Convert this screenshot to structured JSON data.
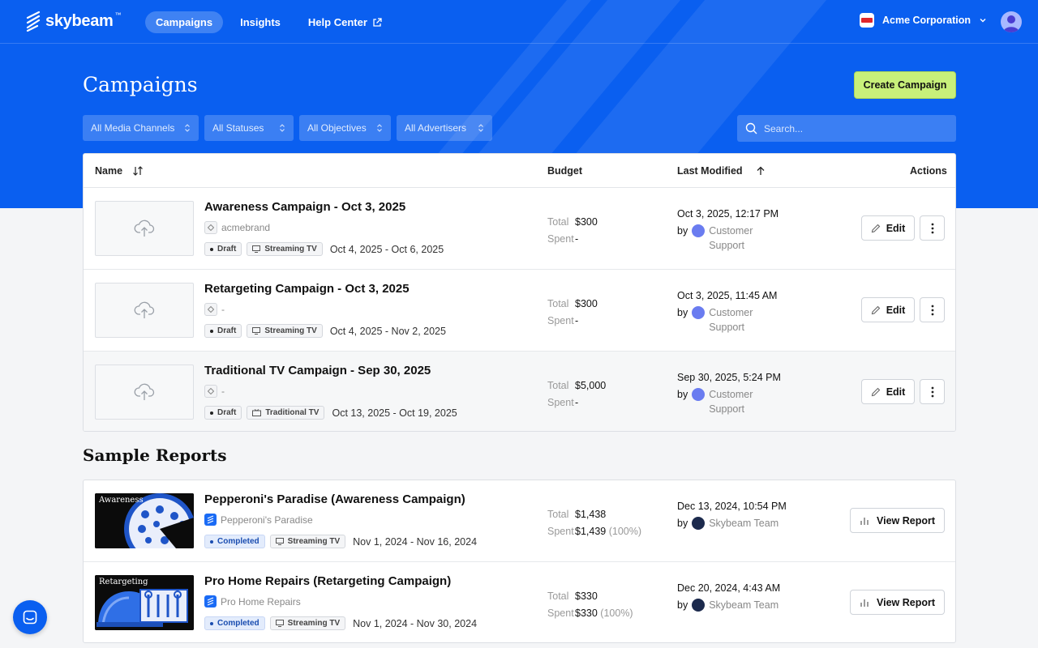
{
  "app": {
    "name": "skybeam",
    "trademark": "™"
  },
  "nav": {
    "campaigns": "Campaigns",
    "insights": "Insights",
    "help": "Help Center"
  },
  "org": {
    "name": "Acme Corporation"
  },
  "page": {
    "title": "Campaigns",
    "create_label": "Create Campaign"
  },
  "filters": {
    "media": "All Media Channels",
    "statuses": "All Statuses",
    "objectives": "All Objectives",
    "advertisers": "All Advertisers"
  },
  "search": {
    "placeholder": "Search..."
  },
  "table": {
    "headers": {
      "name": "Name",
      "budget": "Budget",
      "modified": "Last Modified",
      "actions": "Actions"
    }
  },
  "labels": {
    "total": "Total",
    "spent": "Spent",
    "by": "by",
    "edit": "Edit",
    "view_report": "View Report"
  },
  "campaigns": [
    {
      "title": "Awareness Campaign - Oct 3, 2025",
      "brand": "acmebrand",
      "status": "Draft",
      "channel": "Streaming TV",
      "dates": "Oct 4, 2025 - Oct 6, 2025",
      "total": "$300",
      "spent": "-",
      "modified": "Oct 3, 2025, 12:17 PM",
      "author_line1": "Customer",
      "author_line2": "Support"
    },
    {
      "title": "Retargeting Campaign - Oct 3, 2025",
      "brand": "-",
      "status": "Draft",
      "channel": "Streaming TV",
      "dates": "Oct 4, 2025 - Nov 2, 2025",
      "total": "$300",
      "spent": "-",
      "modified": "Oct 3, 2025, 11:45 AM",
      "author_line1": "Customer",
      "author_line2": "Support"
    },
    {
      "title": "Traditional TV Campaign - Sep 30, 2025",
      "brand": "-",
      "status": "Draft",
      "channel": "Traditional TV",
      "dates": "Oct 13, 2025 - Oct 19, 2025",
      "total": "$5,000",
      "spent": "-",
      "modified": "Sep 30, 2025, 5:24 PM",
      "author_line1": "Customer",
      "author_line2": "Support"
    }
  ],
  "sample_reports": {
    "title": "Sample Reports",
    "items": [
      {
        "thumb_label": "Awareness",
        "title": "Pepperoni's Paradise (Awareness Campaign)",
        "brand": "Pepperoni's Paradise",
        "status": "Completed",
        "channel": "Streaming TV",
        "dates": "Nov 1, 2024 - Nov 16, 2024",
        "total": "$1,438",
        "spent": "$1,439",
        "pct": "(100%)",
        "modified": "Dec 13, 2024, 10:54 PM",
        "author": "Skybeam Team"
      },
      {
        "thumb_label": "Retargeting",
        "title": "Pro Home Repairs (Retargeting Campaign)",
        "brand": "Pro Home Repairs",
        "status": "Completed",
        "channel": "Streaming TV",
        "dates": "Nov 1, 2024 - Nov 30, 2024",
        "total": "$330",
        "spent": "$330",
        "pct": "(100%)",
        "modified": "Dec 20, 2024, 4:43 AM",
        "author": "Skybeam Team"
      }
    ]
  },
  "colors": {
    "brand_blue": "#0a5ff0",
    "create_button": "#c8f07a",
    "completed_badge": "#e3ecfc"
  }
}
